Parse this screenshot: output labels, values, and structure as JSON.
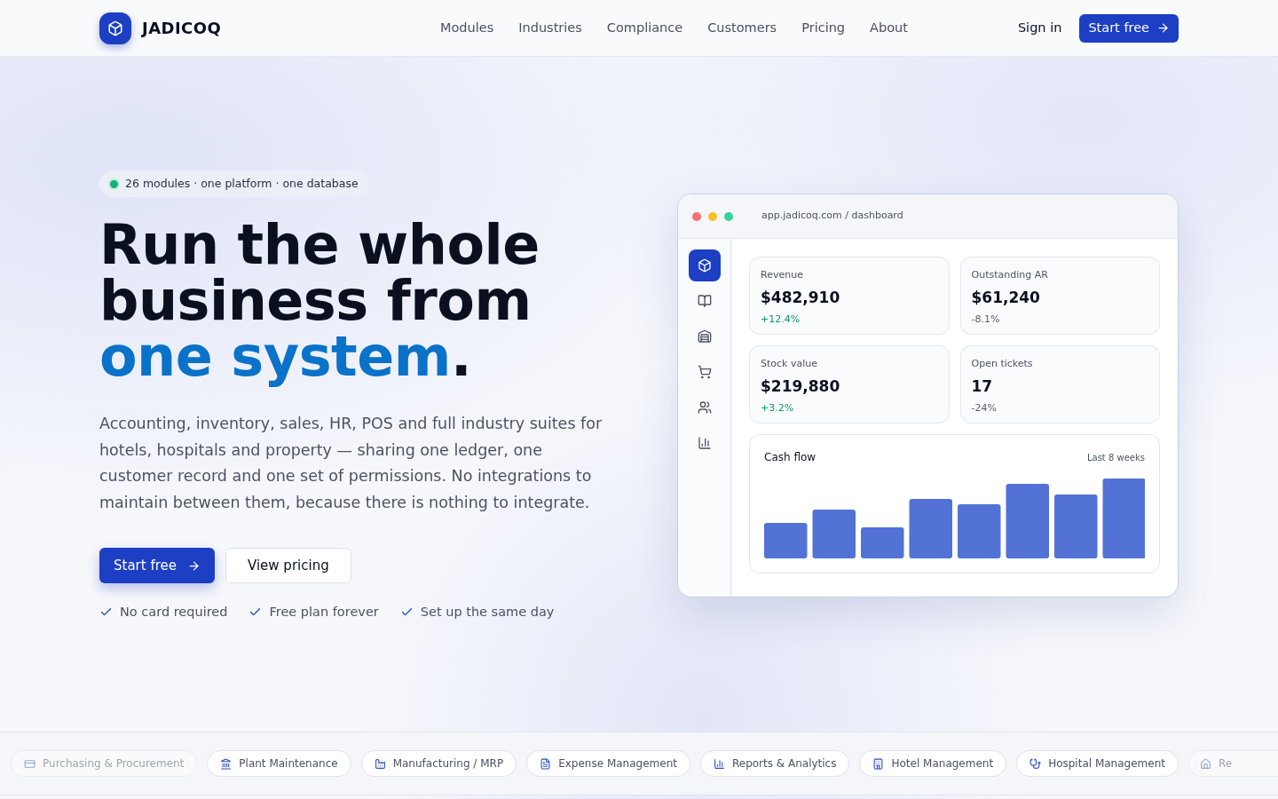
{
  "nav": {
    "brand": "JADICOQ",
    "links": [
      "Modules",
      "Industries",
      "Compliance",
      "Customers",
      "Pricing",
      "About"
    ],
    "sign_in": "Sign in",
    "cta": "Start free"
  },
  "hero": {
    "badge": "26 modules · one platform · one database",
    "headline": "Run the whole business from",
    "headline_accent": "one system",
    "headline_end": ".",
    "description": "Accounting, inventory, sales, HR, POS and full industry suites for hotels, hospitals and property — sharing one ledger, one customer record and one set of permissions. No integrations to maintain between them, because there is nothing to integrate.",
    "primary_button": "Start free",
    "secondary_button": "View pricing",
    "perks": [
      "No card required",
      "Free plan forever",
      "Set up the same day"
    ]
  },
  "dashboard": {
    "address": "app.jadicoq.com / dashboard",
    "sidebar": [
      {
        "kind": "box",
        "selected": true
      },
      {
        "kind": "book",
        "selected": false
      },
      {
        "kind": "warehouse",
        "selected": false
      },
      {
        "kind": "cart",
        "selected": false
      },
      {
        "kind": "users",
        "selected": false
      },
      {
        "kind": "chart",
        "selected": false
      }
    ],
    "stats": [
      {
        "label": "Revenue",
        "value": "$482,910",
        "change": "+12.4%",
        "positive": true
      },
      {
        "label": "Outstanding AR",
        "value": "$61,240",
        "change": "-8.1%",
        "positive": false
      },
      {
        "label": "Stock value",
        "value": "$219,880",
        "change": "+3.2%",
        "positive": true
      },
      {
        "label": "Open tickets",
        "value": "17",
        "change": "-24%",
        "positive": false
      }
    ],
    "cash_flow": {
      "title": "Cash flow",
      "period": "Last 8 weeks"
    }
  },
  "modules": [
    {
      "label": "Purchasing & Procurement",
      "kind": "card"
    },
    {
      "label": "Plant Maintenance",
      "kind": "bank"
    },
    {
      "label": "Manufacturing / MRP",
      "kind": "factory"
    },
    {
      "label": "Expense Management",
      "kind": "receipt"
    },
    {
      "label": "Reports & Analytics",
      "kind": "chart"
    },
    {
      "label": "Hotel Management",
      "kind": "hotel"
    },
    {
      "label": "Hospital Management",
      "kind": "stethoscope"
    },
    {
      "label": "Re",
      "kind": "home"
    }
  ]
}
